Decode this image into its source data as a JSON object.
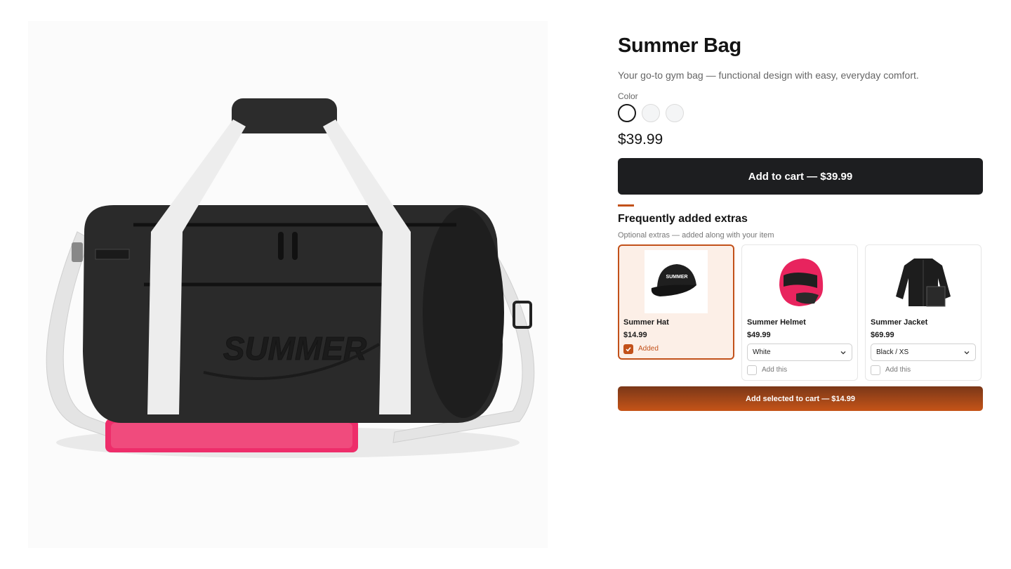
{
  "product": {
    "title": "Summer Bag",
    "description": "Your go-to gym bag — functional design with easy, everyday comfort.",
    "color_label": "Color",
    "price": "$39.99",
    "add_to_cart": "Add to cart — $39.99",
    "image_logo_text": "SUMMER"
  },
  "extras": {
    "title": "Frequently added extras",
    "subtitle": "Optional extras — added along with your item",
    "items": [
      {
        "name": "Summer Hat",
        "price": "$14.99",
        "check_label": "Added",
        "checked": true
      },
      {
        "name": "Summer Helmet",
        "price": "$49.99",
        "variant": "White",
        "check_label": "Add this",
        "checked": false
      },
      {
        "name": "Summer Jacket",
        "price": "$69.99",
        "variant": "Black / XS",
        "check_label": "Add this",
        "checked": false
      }
    ],
    "bundle_button": "Add selected to cart — $14.99"
  },
  "colors": {
    "accent": "#c2511a",
    "primary_button": "#1d1e20",
    "helmet_pink": "#e8245e"
  }
}
